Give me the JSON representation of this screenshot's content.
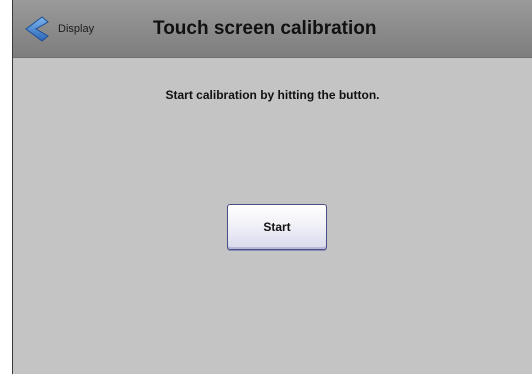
{
  "header": {
    "back_label": "Display",
    "back_icon": "chevron-left-icon",
    "title": "Touch screen calibration"
  },
  "main": {
    "instruction": "Start calibration by hitting the button.",
    "start_label": "Start"
  },
  "colors": {
    "background": "#c4c4c4",
    "header": "#8a8a8a",
    "accent": "#3f7fcf",
    "button_border": "#4a4e86"
  }
}
